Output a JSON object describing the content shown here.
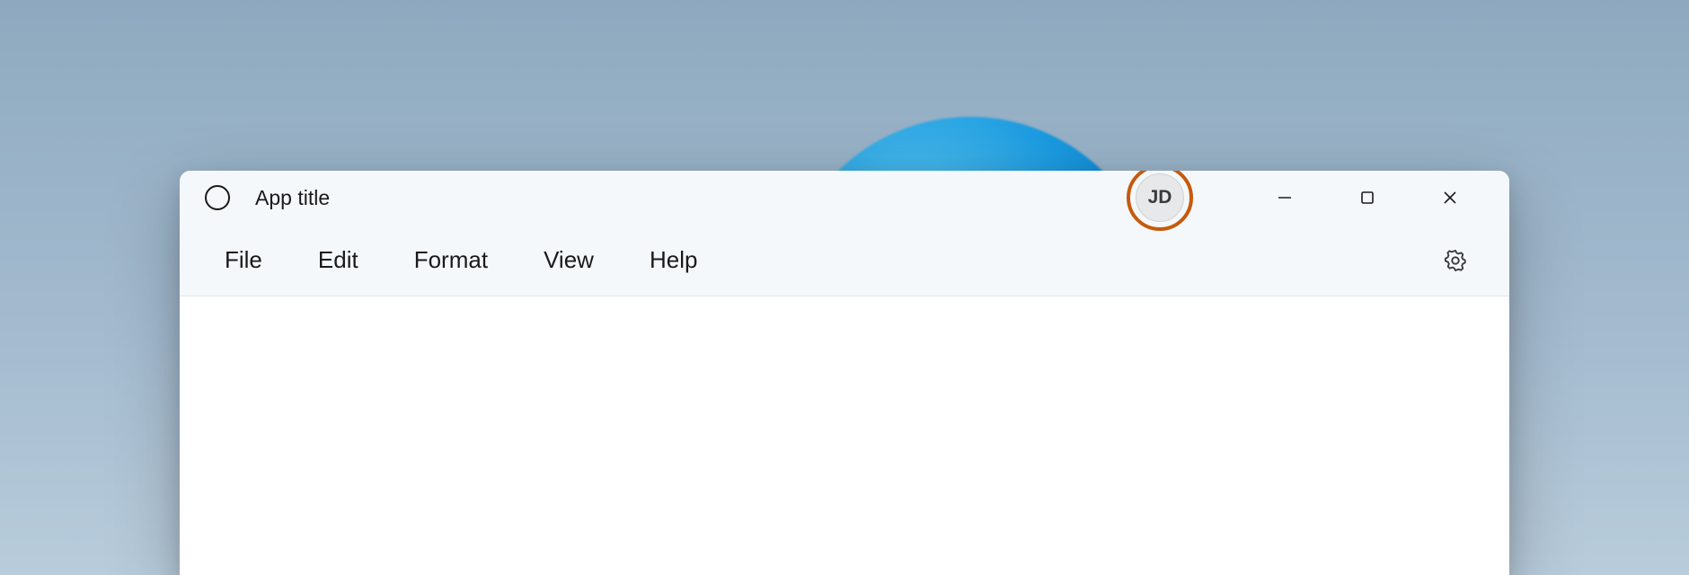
{
  "titlebar": {
    "app_title": "App title",
    "avatar_initials": "JD"
  },
  "menubar": {
    "items": [
      {
        "label": "File"
      },
      {
        "label": "Edit"
      },
      {
        "label": "Format"
      },
      {
        "label": "View"
      },
      {
        "label": "Help"
      }
    ]
  }
}
